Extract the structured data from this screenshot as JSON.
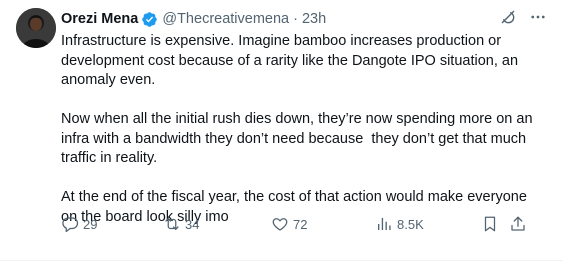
{
  "tweet": {
    "author_name": "Orezi Mena",
    "handle": "@Thecreativemena",
    "separator": "·",
    "time": "23h",
    "paragraphs": [
      [
        "Infrastructure is expensive. Imagine bamboo increases production or",
        "development cost because of a rarity like the Dangote IPO situation, an",
        "anomaly even."
      ],
      [
        "Now when all the initial rush dies down, they’re now spending more on an",
        "infra with a bandwidth they don’t need because  they don’t get that much",
        "traffic in reality."
      ],
      [
        "At the end of the fiscal year, the cost of that action would make everyone",
        "on the board look silly imo"
      ]
    ],
    "stats": {
      "replies": "29",
      "reposts": "34",
      "likes": "72",
      "views": "8.5K"
    }
  },
  "colors": {
    "text": "#0f1419",
    "secondary": "#536471",
    "verified": "#1d9bf0"
  },
  "icons": [
    "verified-badge-icon",
    "grok-icon",
    "more-icon",
    "reply-icon",
    "repost-icon",
    "like-icon",
    "views-icon",
    "bookmark-icon",
    "share-icon"
  ]
}
